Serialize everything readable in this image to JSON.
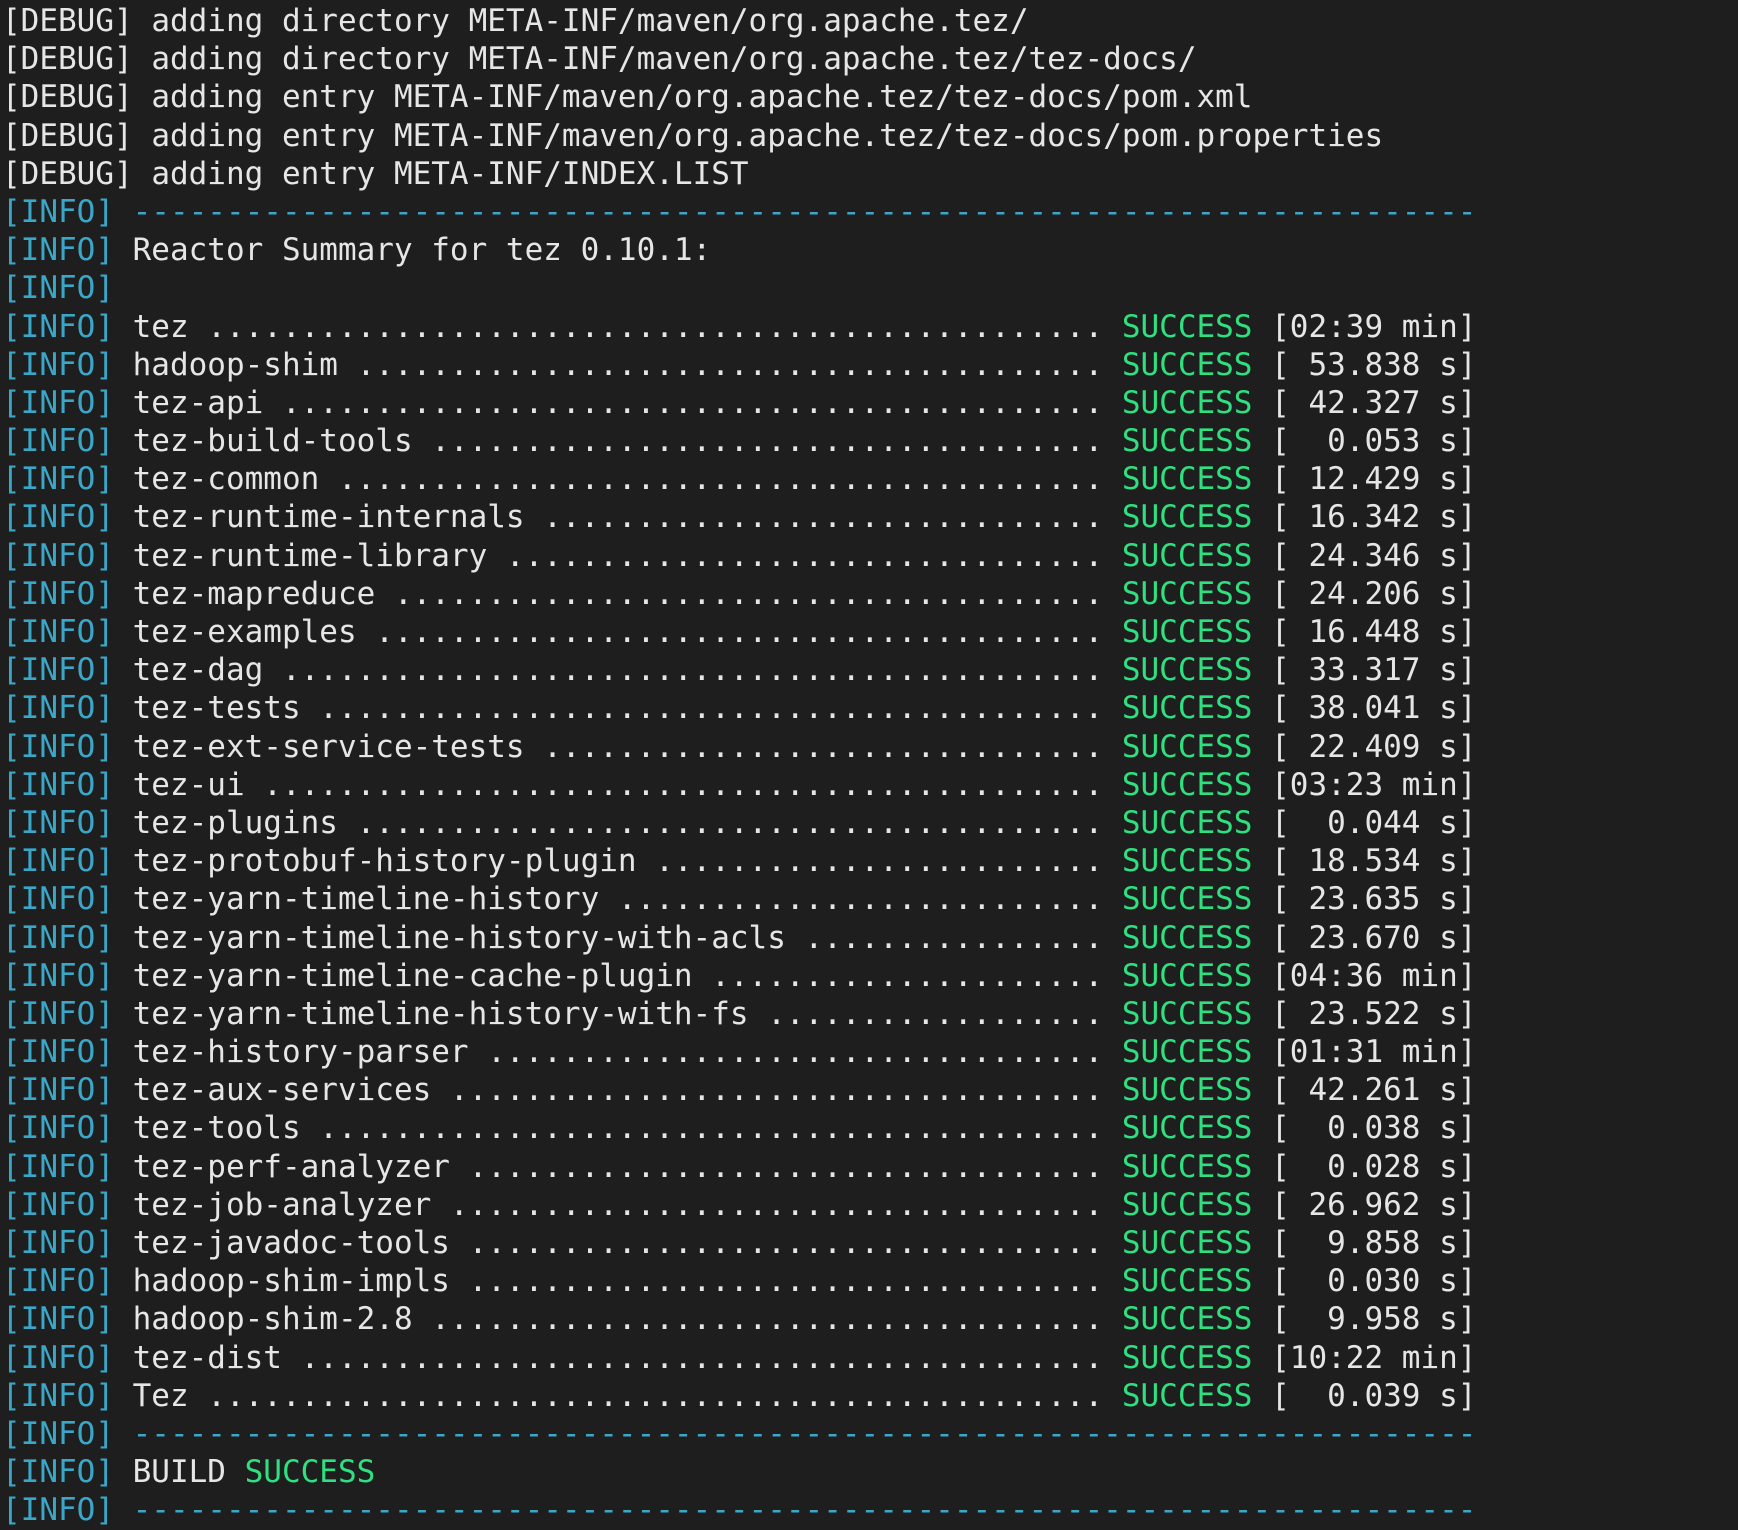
{
  "colors": {
    "background": "#1e1e1e",
    "text": "#e6e6e6",
    "info_tag": "#3aa6c8",
    "separator": "#3aa6c8",
    "success": "#2ee07f"
  },
  "tags": {
    "debug": "[DEBUG]",
    "info": "[INFO]"
  },
  "debug_lines": [
    " adding directory META-INF/maven/org.apache.tez/",
    " adding directory META-INF/maven/org.apache.tez/tez-docs/",
    " adding entry META-INF/maven/org.apache.tez/tez-docs/pom.xml",
    " adding entry META-INF/maven/org.apache.tez/tez-docs/pom.properties",
    " adding entry META-INF/INDEX.LIST"
  ],
  "separator": " ------------------------------------------------------------------------",
  "reactor_title": " Reactor Summary for tez 0.10.1:",
  "modules": [
    {
      "dots": " tez ................................................ ",
      "status": "SUCCESS",
      "time": " [02:39 min]"
    },
    {
      "dots": " hadoop-shim ........................................ ",
      "status": "SUCCESS",
      "time": " [ 53.838 s]"
    },
    {
      "dots": " tez-api ............................................ ",
      "status": "SUCCESS",
      "time": " [ 42.327 s]"
    },
    {
      "dots": " tez-build-tools .................................... ",
      "status": "SUCCESS",
      "time": " [  0.053 s]"
    },
    {
      "dots": " tez-common ......................................... ",
      "status": "SUCCESS",
      "time": " [ 12.429 s]"
    },
    {
      "dots": " tez-runtime-internals .............................. ",
      "status": "SUCCESS",
      "time": " [ 16.342 s]"
    },
    {
      "dots": " tez-runtime-library ................................ ",
      "status": "SUCCESS",
      "time": " [ 24.346 s]"
    },
    {
      "dots": " tez-mapreduce ...................................... ",
      "status": "SUCCESS",
      "time": " [ 24.206 s]"
    },
    {
      "dots": " tez-examples ....................................... ",
      "status": "SUCCESS",
      "time": " [ 16.448 s]"
    },
    {
      "dots": " tez-dag ............................................ ",
      "status": "SUCCESS",
      "time": " [ 33.317 s]"
    },
    {
      "dots": " tez-tests .......................................... ",
      "status": "SUCCESS",
      "time": " [ 38.041 s]"
    },
    {
      "dots": " tez-ext-service-tests .............................. ",
      "status": "SUCCESS",
      "time": " [ 22.409 s]"
    },
    {
      "dots": " tez-ui ............................................. ",
      "status": "SUCCESS",
      "time": " [03:23 min]"
    },
    {
      "dots": " tez-plugins ........................................ ",
      "status": "SUCCESS",
      "time": " [  0.044 s]"
    },
    {
      "dots": " tez-protobuf-history-plugin ........................ ",
      "status": "SUCCESS",
      "time": " [ 18.534 s]"
    },
    {
      "dots": " tez-yarn-timeline-history .......................... ",
      "status": "SUCCESS",
      "time": " [ 23.635 s]"
    },
    {
      "dots": " tez-yarn-timeline-history-with-acls ................ ",
      "status": "SUCCESS",
      "time": " [ 23.670 s]"
    },
    {
      "dots": " tez-yarn-timeline-cache-plugin ..................... ",
      "status": "SUCCESS",
      "time": " [04:36 min]"
    },
    {
      "dots": " tez-yarn-timeline-history-with-fs .................. ",
      "status": "SUCCESS",
      "time": " [ 23.522 s]"
    },
    {
      "dots": " tez-history-parser ................................. ",
      "status": "SUCCESS",
      "time": " [01:31 min]"
    },
    {
      "dots": " tez-aux-services ................................... ",
      "status": "SUCCESS",
      "time": " [ 42.261 s]"
    },
    {
      "dots": " tez-tools .......................................... ",
      "status": "SUCCESS",
      "time": " [  0.038 s]"
    },
    {
      "dots": " tez-perf-analyzer .................................. ",
      "status": "SUCCESS",
      "time": " [  0.028 s]"
    },
    {
      "dots": " tez-job-analyzer ................................... ",
      "status": "SUCCESS",
      "time": " [ 26.962 s]"
    },
    {
      "dots": " tez-javadoc-tools .................................. ",
      "status": "SUCCESS",
      "time": " [  9.858 s]"
    },
    {
      "dots": " hadoop-shim-impls .................................. ",
      "status": "SUCCESS",
      "time": " [  0.030 s]"
    },
    {
      "dots": " hadoop-shim-2.8 .................................... ",
      "status": "SUCCESS",
      "time": " [  9.958 s]"
    },
    {
      "dots": " tez-dist ........................................... ",
      "status": "SUCCESS",
      "time": " [10:22 min]"
    },
    {
      "dots": " Tez ................................................ ",
      "status": "SUCCESS",
      "time": " [  0.039 s]"
    }
  ],
  "build": {
    "label": " BUILD ",
    "status": "SUCCESS"
  }
}
